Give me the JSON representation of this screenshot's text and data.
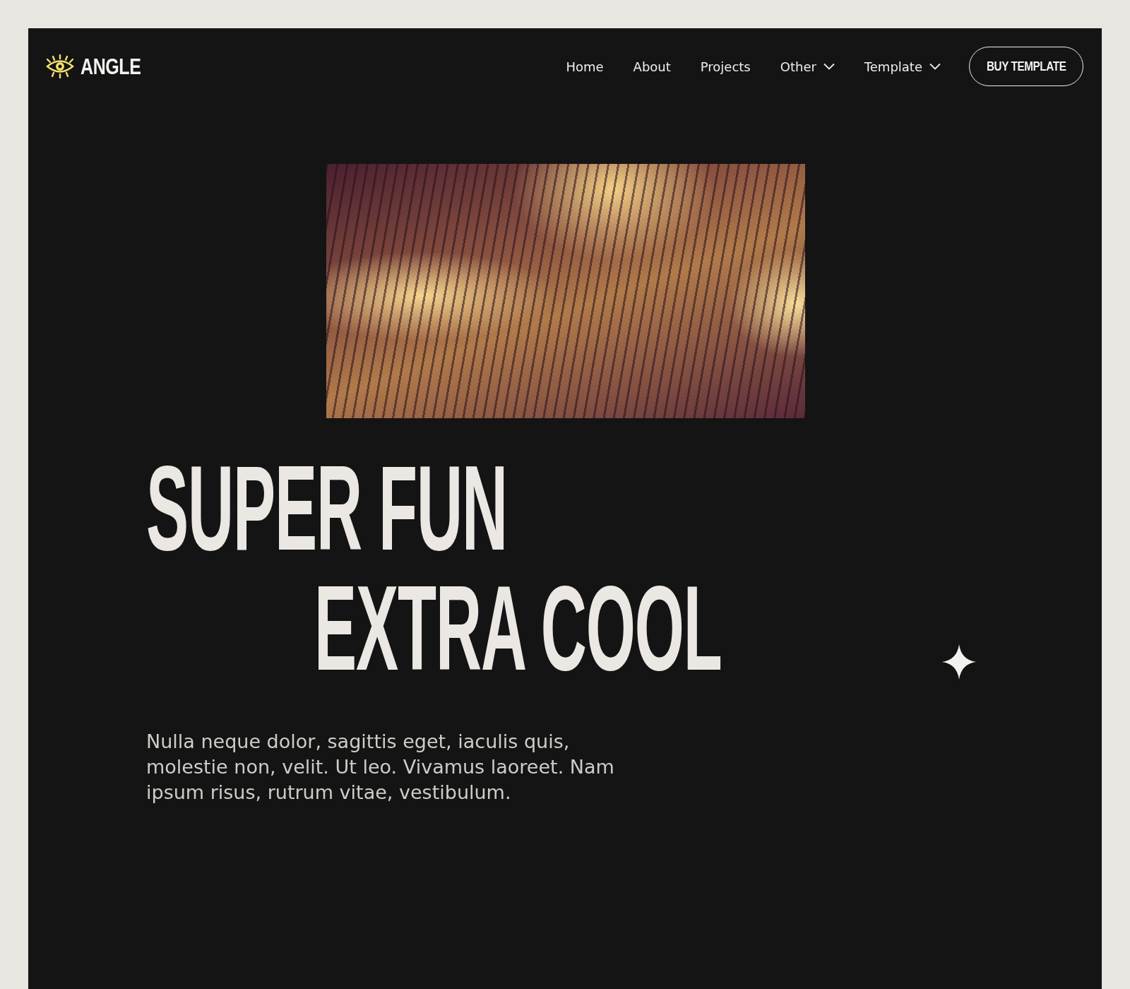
{
  "brand": {
    "name": "ANGLE"
  },
  "nav": [
    {
      "label": "Home",
      "kind": "link"
    },
    {
      "label": "About",
      "kind": "link"
    },
    {
      "label": "Projects",
      "kind": "link"
    },
    {
      "label": "Other",
      "kind": "dropdown"
    },
    {
      "label": "Template",
      "kind": "dropdown"
    }
  ],
  "cta": {
    "label": "BUY TEMPLATE"
  },
  "hero": {
    "lines": [
      "SUPER FUN",
      "EXTRA COOL"
    ],
    "text": "Nulla neque dolor, sagittis eget, iaculis quis, molestie non, velit. Ut leo. Vivamus laoreet. Nam ipsum risus, rutrum vitae, vestibulum."
  }
}
